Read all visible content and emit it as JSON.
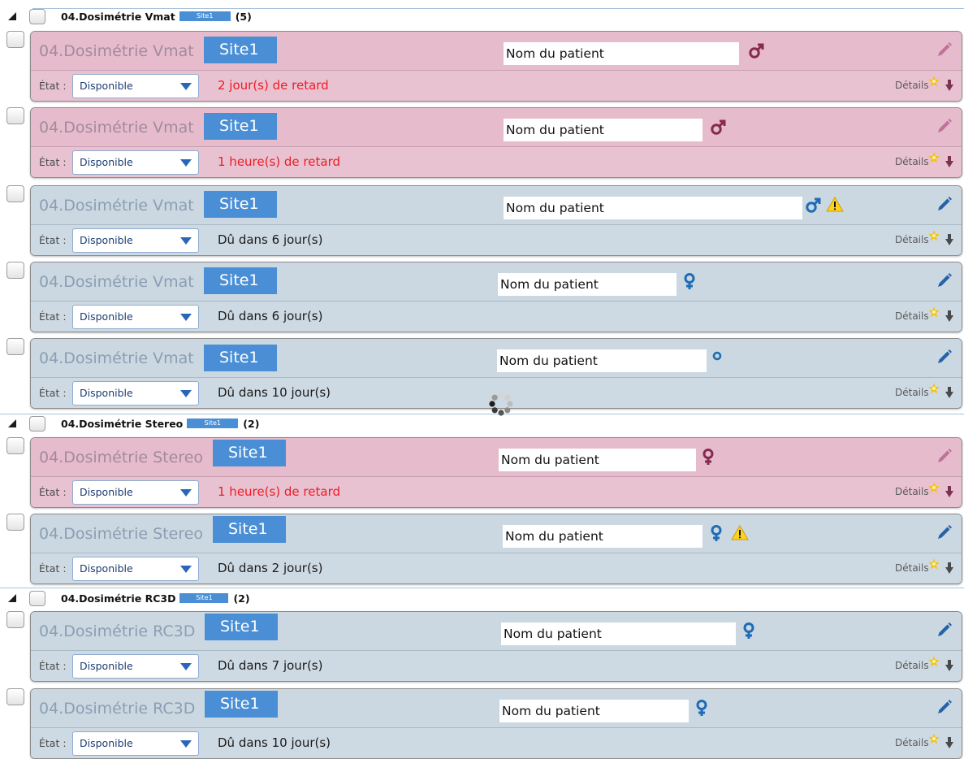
{
  "labels": {
    "state": "État :",
    "details": "Détails"
  },
  "colors": {
    "late_header": "#e6bccc",
    "late_footer": "#e8c2d1",
    "due_header": "#cbd8e1",
    "due_footer": "#cedae3",
    "late_status_text": "#ee1b24",
    "site_badge": "#4a8fd6",
    "late_icon": "#862a4e",
    "due_icon": "#1f6cb6",
    "late_pencil": "#c0729a",
    "due_pencil": "#2563a8",
    "late_arrow": "#7b3352",
    "due_arrow": "#4a4a4a",
    "warning": "#ffd21f"
  },
  "icons": {
    "group_toggle": "expanded-triangle-icon",
    "edit": "edit-pencil-icon",
    "dropdown": "dropdown-arrow-icon",
    "details_badge": "new-star-icon",
    "expand": "expand-down-arrow-icon",
    "loading": "loading-spinner"
  },
  "groups": [
    {
      "title": "04.Dosimétrie Vmat",
      "site": "Site1",
      "count": "(5)",
      "cards": [
        {
          "title": "04.Dosimétrie Vmat",
          "site": "Site1",
          "patient": "Nom du patient",
          "gender_icon": "male-icon",
          "warning_icon": null,
          "state": "Disponible",
          "status": "2 jour(s) de retard",
          "late": true
        },
        {
          "title": "04.Dosimétrie Vmat",
          "site": "Site1",
          "patient": "Nom du patient",
          "gender_icon": "male-icon",
          "warning_icon": null,
          "state": "Disponible",
          "status": "1 heure(s) de retard",
          "late": true
        },
        {
          "title": "04.Dosimétrie Vmat",
          "site": "Site1",
          "patient": "Nom du patient",
          "gender_icon": "male-icon",
          "warning_icon": "warning-icon",
          "state": "Disponible",
          "status": "Dû dans 6 jour(s)",
          "late": false
        },
        {
          "title": "04.Dosimétrie Vmat",
          "site": "Site1",
          "patient": "Nom du patient",
          "gender_icon": "female-icon",
          "warning_icon": null,
          "state": "Disponible",
          "status": "Dû dans 6 jour(s)",
          "late": false
        },
        {
          "title": "04.Dosimétrie Vmat",
          "site": "Site1",
          "patient": "Nom du patient",
          "gender_icon": "gender-unspecified-icon",
          "warning_icon": null,
          "state": "Disponible",
          "status": "Dû dans 10 jour(s)",
          "late": false
        }
      ]
    },
    {
      "title": "04.Dosimétrie Stereo",
      "site": "Site1",
      "count": "(2)",
      "cards": [
        {
          "title": "04.Dosimétrie Stereo",
          "site": "Site1",
          "patient": "Nom du patient",
          "gender_icon": "female-icon",
          "warning_icon": null,
          "state": "Disponible",
          "status": "1 heure(s) de retard",
          "late": true
        },
        {
          "title": "04.Dosimétrie Stereo",
          "site": "Site1",
          "patient": "Nom du patient",
          "gender_icon": "female-icon",
          "warning_icon": "warning-icon",
          "state": "Disponible",
          "status": "Dû dans 2 jour(s)",
          "late": false
        }
      ]
    },
    {
      "title": "04.Dosimétrie RC3D",
      "site": "Site1",
      "count": "(2)",
      "cards": [
        {
          "title": "04.Dosimétrie RC3D",
          "site": "Site1",
          "patient": "Nom du patient",
          "gender_icon": "female-icon",
          "warning_icon": null,
          "state": "Disponible",
          "status": "Dû dans 7 jour(s)",
          "late": false
        },
        {
          "title": "04.Dosimétrie RC3D",
          "site": "Site1",
          "patient": "Nom du patient",
          "gender_icon": "female-icon",
          "warning_icon": null,
          "state": "Disponible",
          "status": "Dû dans 10 jour(s)",
          "late": false
        }
      ]
    }
  ]
}
